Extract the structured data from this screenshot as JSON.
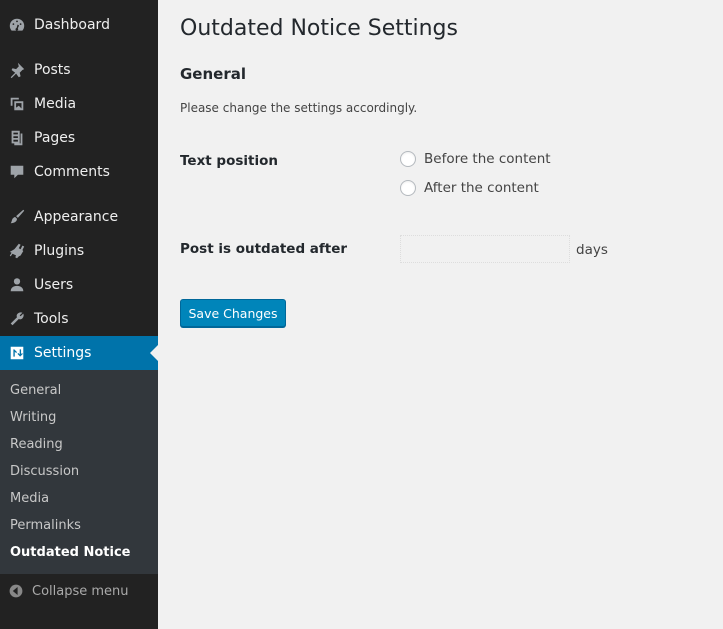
{
  "sidebar": {
    "menu": [
      {
        "label": "Dashboard",
        "icon": "dashboard-icon"
      },
      {
        "label": "Posts",
        "icon": "pin-icon"
      },
      {
        "label": "Media",
        "icon": "media-icon"
      },
      {
        "label": "Pages",
        "icon": "pages-icon"
      },
      {
        "label": "Comments",
        "icon": "comment-icon"
      },
      {
        "label": "Appearance",
        "icon": "paintbrush-icon"
      },
      {
        "label": "Plugins",
        "icon": "plugin-icon"
      },
      {
        "label": "Users",
        "icon": "users-icon"
      },
      {
        "label": "Tools",
        "icon": "wrench-icon"
      },
      {
        "label": "Settings",
        "icon": "settings-icon"
      }
    ],
    "submenu": [
      "General",
      "Writing",
      "Reading",
      "Discussion",
      "Media",
      "Permalinks",
      "Outdated Notice"
    ],
    "collapse_label": "Collapse menu"
  },
  "main": {
    "title": "Outdated Notice Settings",
    "section_title": "General",
    "description": "Please change the settings accordingly.",
    "text_position": {
      "label": "Text position",
      "options": [
        "Before the content",
        "After the content"
      ]
    },
    "outdated": {
      "label": "Post is outdated after",
      "value": "",
      "unit": "days"
    },
    "save_label": "Save Changes"
  },
  "colors": {
    "sidebar_bg": "#222222",
    "submenu_bg": "#32373c",
    "accent": "#0073aa",
    "button": "#0085ba",
    "page_bg": "#f1f1f1"
  }
}
